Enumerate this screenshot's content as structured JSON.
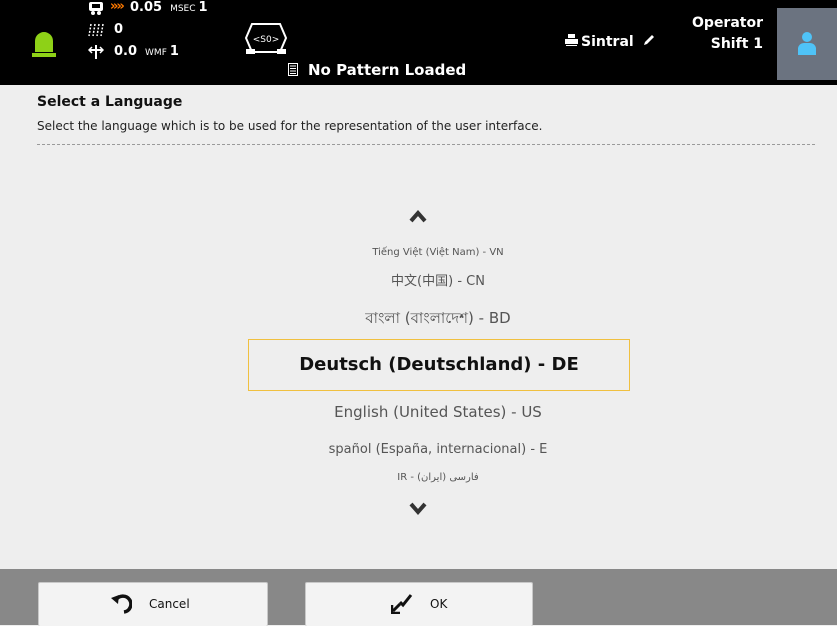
{
  "status": {
    "speed_value": "0.05",
    "speed_unit": "MSEC",
    "speed_unit_value": "1",
    "counter_value": "0",
    "wmf_value": "0.0",
    "wmf_unit": "WMF",
    "wmf_unit_value": "1",
    "lamp_color": "#8ed117",
    "chevron_color": "#ff7a00"
  },
  "so_label": "<S0>",
  "pattern_text": "No Pattern Loaded",
  "machine_name": "Sintral",
  "operator": {
    "role": "Operator",
    "shift": "Shift 1"
  },
  "page": {
    "title": "Select a Language",
    "description": "Select the language which is to be used for the representation of the user interface."
  },
  "languages": [
    "Tiếng Việt (Việt Nam) - VN",
    "中文(中国) - CN",
    "বাংলা (বাংলাদেশ) - BD",
    "Deutsch (Deutschland) - DE",
    "English (United States) - US",
    "spañol (España, internacional) - E",
    "IR - (فارسی (ایران"
  ],
  "selected_language": "Deutsch (Deutschland) - DE",
  "footer": {
    "cancel_label": "Cancel",
    "ok_label": "OK"
  }
}
